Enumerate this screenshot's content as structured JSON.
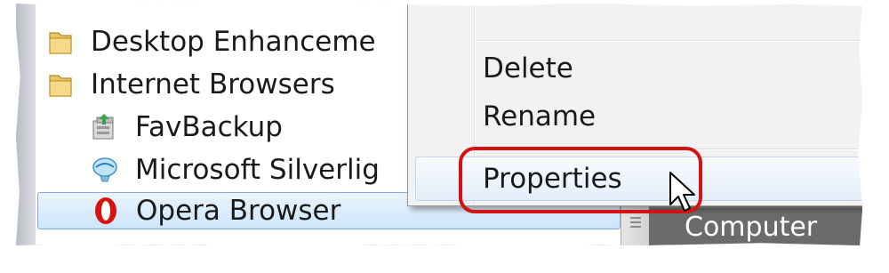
{
  "tree": {
    "items": [
      {
        "label": "Desktop Enhanceme",
        "icon": "folder-icon"
      },
      {
        "label": "Internet Browsers",
        "icon": "folder-icon"
      },
      {
        "label": "FavBackup",
        "icon": "favbackup-app-icon"
      },
      {
        "label": "Microsoft Silverlig",
        "icon": "silverlight-app-icon"
      },
      {
        "label": "Opera Browser",
        "icon": "opera-logo-icon",
        "selected": true
      }
    ]
  },
  "context_menu": {
    "items": [
      {
        "label": "Delete"
      },
      {
        "label": "Rename"
      },
      {
        "label": "Properties",
        "hovered": true
      }
    ]
  },
  "taskbar": {
    "computer_label": "Computer"
  },
  "colors": {
    "selection_fill": "#cde5fa",
    "selection_border": "#84acdd",
    "highlight_ring": "#d51212",
    "menu_background": "#f2f2f2",
    "taskbar": "#6b6b6b"
  }
}
